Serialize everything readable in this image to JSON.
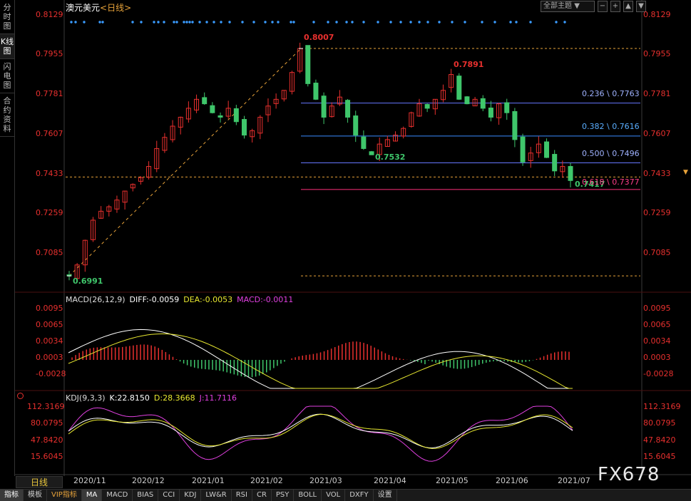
{
  "header": {
    "symbol": "澳元美元",
    "period": "<日线>",
    "theme_label": "全部主题",
    "theme_arrow": "▼"
  },
  "left_tabs": [
    "分时图",
    "K线图",
    "闪电图",
    "合约资料"
  ],
  "colors": {
    "up": "#e8302e",
    "down": "#3fc66b",
    "bg": "#000000",
    "fib": "#5570ff",
    "accent": "#e8a33a"
  },
  "price_axis": [
    "0.8129",
    "0.7955",
    "0.7781",
    "0.7607",
    "0.7433",
    "0.7259",
    "0.7085"
  ],
  "price_labels": {
    "high": "0.8007",
    "low": "0.6991",
    "mid_high": "0.7891",
    "mid_low": "0.7532",
    "last": "0.7417"
  },
  "fib_levels": [
    {
      "ratio": "0.236",
      "value": "0.7763",
      "label": "0.236 \\ 0.7763"
    },
    {
      "ratio": "0.382",
      "value": "0.7616",
      "label": "0.382 \\ 0.7616"
    },
    {
      "ratio": "0.500",
      "value": "0.7496",
      "label": "0.500 \\ 0.7496"
    },
    {
      "ratio": "0.618",
      "value": "0.7377",
      "label": "0.618 \\ 0.7377"
    }
  ],
  "macd": {
    "title": "MACD(26,12,9)",
    "diff": "DIFF:-0.0059",
    "dea": "DEA:-0.0053",
    "macd": "MACD:-0.0011",
    "axis": [
      "0.0095",
      "0.0065",
      "0.0034",
      "0.0003",
      "-0.0028"
    ]
  },
  "kdj": {
    "title": "KDJ(9,3,3)",
    "k": "K:22.8150",
    "d": "D:28.3668",
    "j": "J:11.7116",
    "axis": [
      "112.3169",
      "80.0795",
      "47.8420",
      "15.6045"
    ]
  },
  "x_axis": [
    "2020/11",
    "2020/12",
    "2021/01",
    "2021/02",
    "2021/03",
    "2021/04",
    "2021/05",
    "2021/06",
    "2021/07"
  ],
  "period_tab": "日线",
  "bottom_bar": [
    "指标",
    "模板",
    "VIP指标",
    "MA",
    "MACD",
    "BIAS",
    "CCI",
    "KDJ",
    "LW&R",
    "RSI",
    "CR",
    "PSY",
    "BOLL",
    "VOL",
    "DXFY",
    "设置"
  ],
  "watermark": "FX678",
  "chart_data": {
    "type": "candlestick",
    "title": "澳元美元 <日线>",
    "ylim": [
      0.695,
      0.816
    ],
    "series": [
      {
        "name": "price",
        "values": [
          0.6991,
          0.704,
          0.715,
          0.724,
          0.728,
          0.73,
          0.733,
          0.737,
          0.74,
          0.743,
          0.748,
          0.756,
          0.761,
          0.766,
          0.77,
          0.774,
          0.778,
          0.776,
          0.772,
          0.77,
          0.774,
          0.768,
          0.762,
          0.764,
          0.77,
          0.775,
          0.778,
          0.782,
          0.79,
          0.8007,
          0.785,
          0.778,
          0.77,
          0.775,
          0.779,
          0.77,
          0.762,
          0.756,
          0.7532,
          0.758,
          0.76,
          0.762,
          0.765,
          0.772,
          0.776,
          0.774,
          0.778,
          0.782,
          0.7891,
          0.778,
          0.776,
          0.778,
          0.774,
          0.77,
          0.776,
          0.772,
          0.76,
          0.75,
          0.754,
          0.758,
          0.752,
          0.746,
          0.748,
          0.7417
        ]
      }
    ]
  }
}
